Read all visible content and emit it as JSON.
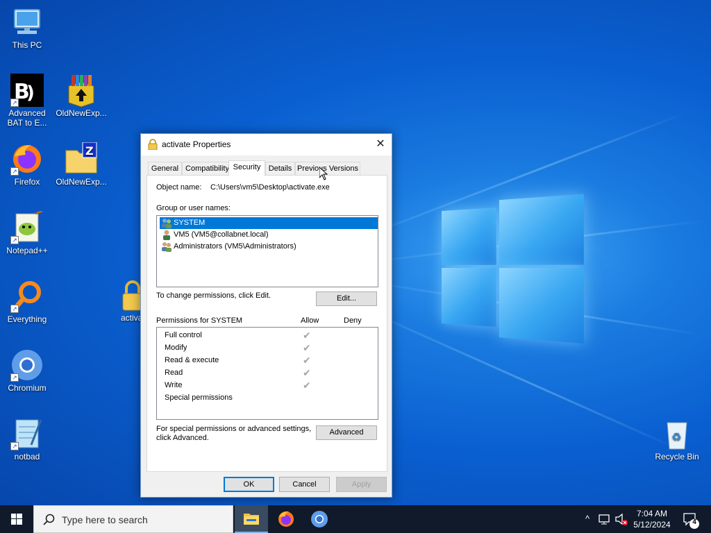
{
  "desktop": {
    "icons": [
      {
        "label": "This PC"
      },
      {
        "label": "Advanced BAT to E..."
      },
      {
        "label": "OldNewExp..."
      },
      {
        "label": "Firefox"
      },
      {
        "label": "OldNewExp..."
      },
      {
        "label": "Notepad++"
      },
      {
        "label": "Everything"
      },
      {
        "label": "activa"
      },
      {
        "label": "Chromium"
      },
      {
        "label": "notbad"
      },
      {
        "label": "Recycle Bin"
      }
    ]
  },
  "dialog": {
    "title": "activate Properties",
    "close_glyph": "✕",
    "tabs": [
      {
        "label": "General"
      },
      {
        "label": "Compatibility"
      },
      {
        "label": "Security",
        "active": true
      },
      {
        "label": "Details"
      },
      {
        "label": "Previous Versions"
      }
    ],
    "object_name_label": "Object name:",
    "object_name_value": "C:\\Users\\vm5\\Desktop\\activate.exe",
    "group_label": "Group or user names:",
    "users": [
      {
        "name": "SYSTEM",
        "selected": true
      },
      {
        "name": "VM5 (VM5@collabnet.local)",
        "selected": false
      },
      {
        "name": "Administrators (VM5\\Administrators)",
        "selected": false
      }
    ],
    "change_text": "To change permissions, click Edit.",
    "edit_button": "Edit...",
    "permissions_for": "Permissions for SYSTEM",
    "allow_header": "Allow",
    "deny_header": "Deny",
    "permissions": [
      {
        "name": "Full control",
        "allow": true,
        "deny": false
      },
      {
        "name": "Modify",
        "allow": true,
        "deny": false
      },
      {
        "name": "Read & execute",
        "allow": true,
        "deny": false
      },
      {
        "name": "Read",
        "allow": true,
        "deny": false
      },
      {
        "name": "Write",
        "allow": true,
        "deny": false
      },
      {
        "name": "Special permissions",
        "allow": false,
        "deny": false
      }
    ],
    "advanced_text_line1": "For special permissions or advanced settings,",
    "advanced_text_line2": "click Advanced.",
    "advanced_button": "Advanced",
    "ok_button": "OK",
    "cancel_button": "Cancel",
    "apply_button": "Apply",
    "check_glyph": "✔"
  },
  "taskbar": {
    "search_placeholder": "Type here to search",
    "time": "7:04 AM",
    "date": "5/12/2024",
    "notification_count": "4",
    "tray_chevron": "^"
  },
  "colors": {
    "accent": "#0078d7",
    "taskbar": "#101a2a",
    "desktop": "#0a5fd0"
  }
}
